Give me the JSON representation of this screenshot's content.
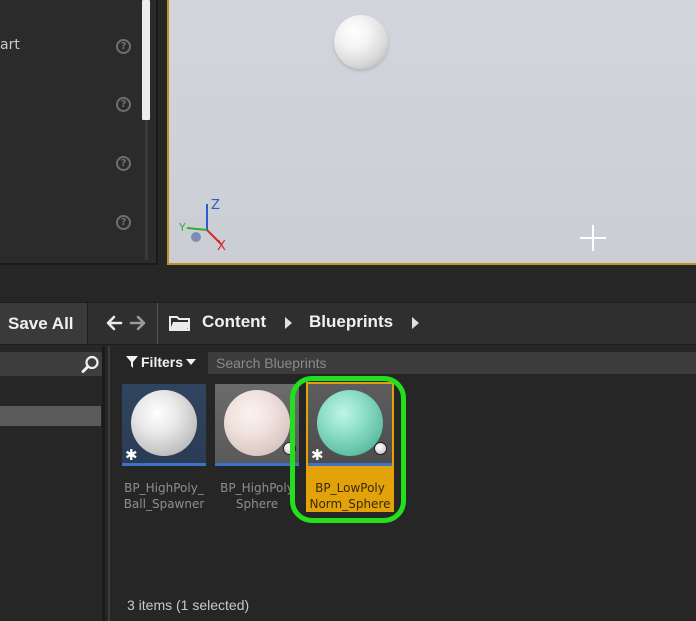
{
  "details_panel": {
    "partial_label": "art"
  },
  "toolbar": {
    "save_all_label": "Save All"
  },
  "breadcrumb": {
    "items": [
      "Content",
      "Blueprints"
    ]
  },
  "content_browser": {
    "filters_label": "Filters",
    "search_placeholder": "Search Blueprints",
    "status_text": "3 items (1 selected)",
    "assets": [
      {
        "name_line1": "BP_HighPoly_",
        "name_line2": "Ball_Spawner",
        "selected": false
      },
      {
        "name_line1": "BP_HighPoly",
        "name_line2": "Sphere",
        "selected": false
      },
      {
        "name_line1": "BP_LowPoly",
        "name_line2": "Norm_Sphere",
        "selected": true
      }
    ]
  },
  "viewport": {
    "axis_z": "Z",
    "axis_y": "Y",
    "axis_x": "X"
  },
  "colors": {
    "selection_highlight": "#e2a20a",
    "annotation_ring": "#22e01c",
    "thumbnail_underline": "#3b73c8"
  }
}
